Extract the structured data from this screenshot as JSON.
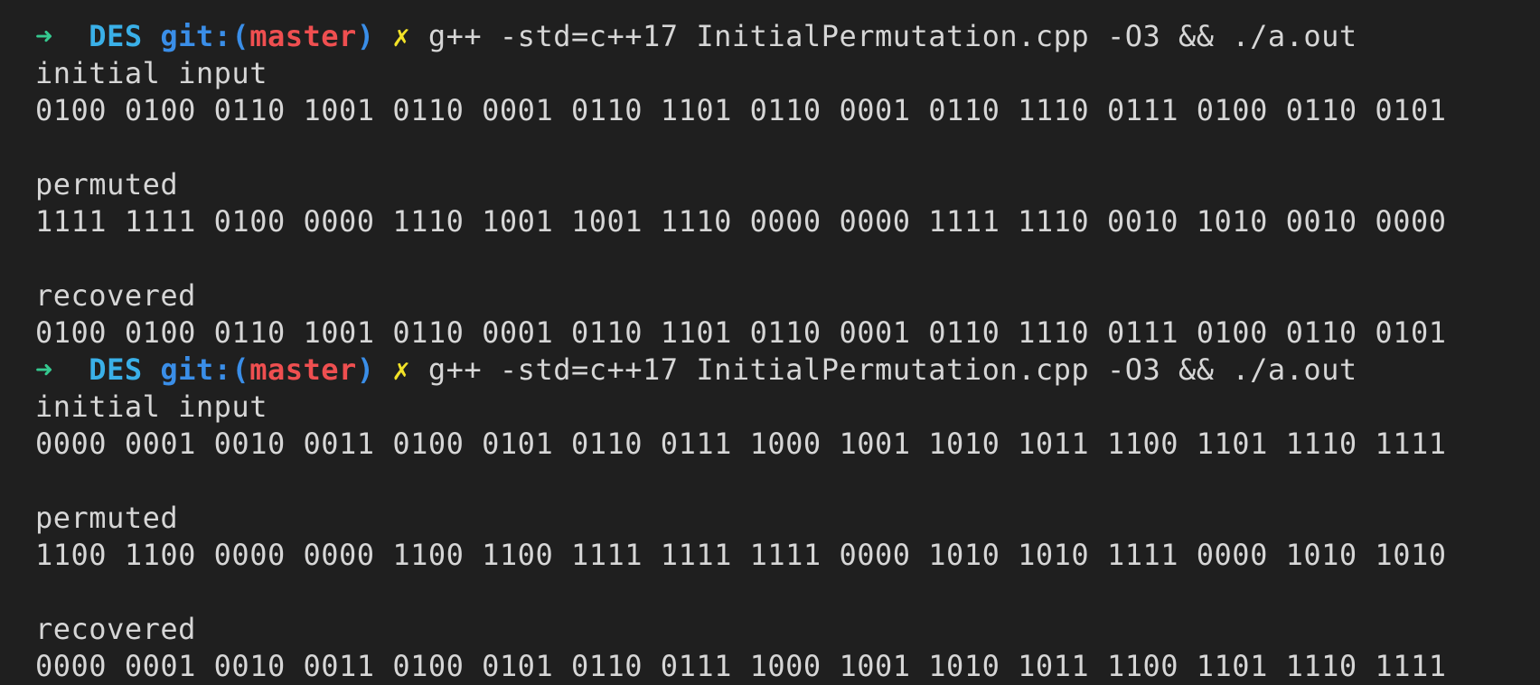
{
  "colors": {
    "background": "#1f1f1f",
    "text": "#d6d6d6",
    "prompt_arrow": "#35c88f",
    "dir": "#3ab0e8",
    "git": "#3a8ee8",
    "branch": "#ef4f50",
    "dirty": "#f2e227"
  },
  "prompt": {
    "arrow": "➜",
    "dir": "DES",
    "git_open": "git:(",
    "branch": "master",
    "git_close": ")",
    "dirty": "✗"
  },
  "runs": [
    {
      "command": "g++ -std=c++17 InitialPermutation.cpp -O3 && ./a.out",
      "initial_label": "initial input",
      "initial_bits": "0100 0100 0110 1001 0110 0001 0110 1101 0110 0001 0110 1110 0111 0100 0110 0101",
      "permuted_label": "permuted",
      "permuted_bits": "1111 1111 0100 0000 1110 1001 1001 1110 0000 0000 1111 1110 0010 1010 0010 0000",
      "recovered_label": "recovered",
      "recovered_bits": "0100 0100 0110 1001 0110 0001 0110 1101 0110 0001 0110 1110 0111 0100 0110 0101"
    },
    {
      "command": "g++ -std=c++17 InitialPermutation.cpp -O3 && ./a.out",
      "initial_label": "initial input",
      "initial_bits": "0000 0001 0010 0011 0100 0101 0110 0111 1000 1001 1010 1011 1100 1101 1110 1111",
      "permuted_label": "permuted",
      "permuted_bits": "1100 1100 0000 0000 1100 1100 1111 1111 1111 0000 1010 1010 1111 0000 1010 1010",
      "recovered_label": "recovered",
      "recovered_bits": "0000 0001 0010 0011 0100 0101 0110 0111 1000 1001 1010 1011 1100 1101 1110 1111"
    }
  ]
}
